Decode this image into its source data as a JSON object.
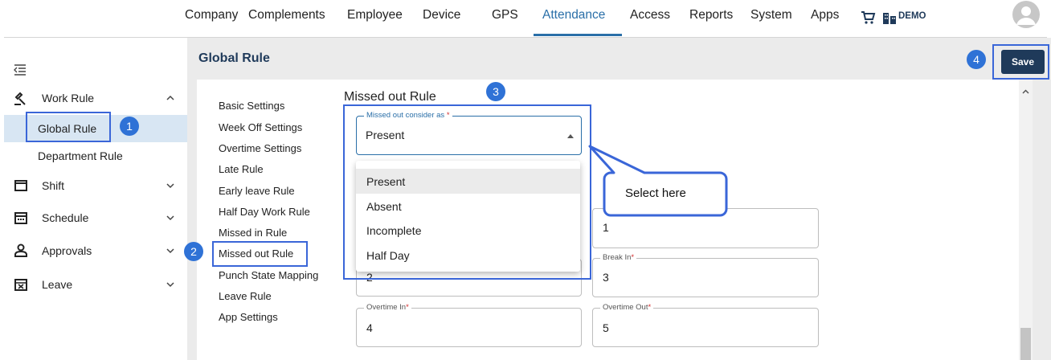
{
  "nav": {
    "items": [
      "Company",
      "Complements",
      "Employee",
      "Device",
      "GPS",
      "Attendance",
      "Access",
      "Reports",
      "System",
      "Apps"
    ],
    "active": "Attendance",
    "org_name": "DEMO"
  },
  "sidebar": {
    "groups": [
      {
        "label": "Work Rule",
        "icon": "gavel-icon",
        "expanded": true
      },
      {
        "label": "Shift",
        "icon": "shift-icon"
      },
      {
        "label": "Schedule",
        "icon": "calendar-icon"
      },
      {
        "label": "Approvals",
        "icon": "approvals-icon"
      },
      {
        "label": "Leave",
        "icon": "leave-icon"
      }
    ],
    "work_rule_children": [
      "Global Rule",
      "Department Rule"
    ],
    "selected": "Global Rule"
  },
  "page": {
    "title": "Global Rule",
    "save_label": "Save"
  },
  "settings_nav": [
    "Basic Settings",
    "Week Off Settings",
    "Overtime Settings",
    "Late Rule",
    "Early leave Rule",
    "Half Day Work Rule",
    "Missed in Rule",
    "Missed out Rule",
    "Punch State Mapping",
    "Leave Rule",
    "App Settings"
  ],
  "form": {
    "section_title": "Missed out Rule",
    "select": {
      "label": "Missed out consider as",
      "value": "Present"
    },
    "options": [
      "Present",
      "Absent",
      "Incomplete",
      "Half Day"
    ],
    "highlighted_option": "Present",
    "fields": {
      "hidden_value_1": "1",
      "break_out_value": "2",
      "break_in_label": "Break In",
      "break_in_value": "3",
      "overtime_in_label": "Overtime In",
      "overtime_in_value": "4",
      "overtime_out_label": "Overtime Out",
      "overtime_out_value": "5"
    }
  },
  "annotations": {
    "badges": [
      "1",
      "2",
      "3",
      "4"
    ],
    "callout": "Select here"
  },
  "colors": {
    "accent": "#2a6fa8",
    "brand_dark": "#1f3a5a",
    "annotation_blue": "#3a66d8",
    "selected_bg": "#d8e6f3"
  }
}
